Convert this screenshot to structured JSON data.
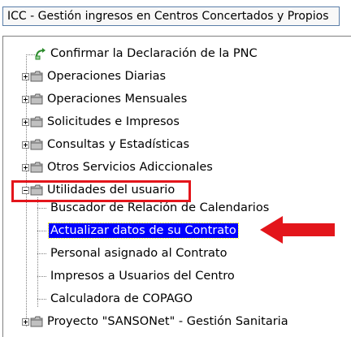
{
  "window": {
    "title": "ICC - Gestión ingresos en Centros Concertados y Propios"
  },
  "tree": {
    "items": [
      {
        "label": "Confirmar la Declaración de la PNC",
        "icon": "green-arrow-doc-icon"
      },
      {
        "label": "Operaciones Diarias",
        "icon": "folder-icon",
        "expander": "plus"
      },
      {
        "label": "Operaciones Mensuales",
        "icon": "folder-icon",
        "expander": "plus"
      },
      {
        "label": "Solicitudes e Impresos",
        "icon": "folder-icon",
        "expander": "plus"
      },
      {
        "label": "Consultas y Estadísticas",
        "icon": "folder-icon",
        "expander": "plus"
      },
      {
        "label": "Otros Servicios Adiccionales",
        "icon": "folder-icon",
        "expander": "plus"
      },
      {
        "label": "Utilidades del usuario",
        "icon": "folder-icon",
        "expander": "minus"
      },
      {
        "label": "Buscador de Relación de Calendarios"
      },
      {
        "label": "Actualizar datos de su Contrato",
        "selected": true
      },
      {
        "label": "Personal asignado al Contrato"
      },
      {
        "label": "Impresos a Usuarios del Centro"
      },
      {
        "label": "Calculadora de COPAGO"
      },
      {
        "label": "Proyecto \"SANSONet\" - Gestión Sanitaria",
        "icon": "folder-icon",
        "expander": "plus"
      }
    ]
  },
  "colors": {
    "selection": "#0000ff",
    "annotation": "#e3151b",
    "folder": "#c0c0c0"
  }
}
